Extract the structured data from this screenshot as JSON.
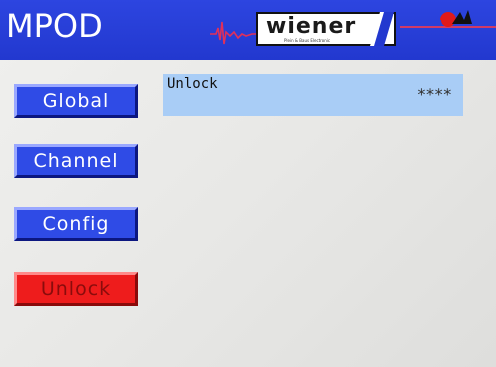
{
  "header": {
    "title": "MPOD",
    "logo_text": "wiener",
    "logo_subtext": "Plein & Baus Electronic"
  },
  "nav": {
    "items": [
      {
        "label": "Global",
        "active": false
      },
      {
        "label": "Channel",
        "active": false
      },
      {
        "label": "Config",
        "active": false
      },
      {
        "label": "Unlock",
        "active": true
      }
    ]
  },
  "content": {
    "rows": [
      {
        "label": "Unlock",
        "value": "∗∗∗∗"
      }
    ]
  },
  "colors": {
    "header_bg": "#2238cf",
    "button_bg": "#2f4be6",
    "active_button_bg": "#ee1c1c",
    "row_bg": "#a9cdf6",
    "accent_line": "#d03a66"
  }
}
